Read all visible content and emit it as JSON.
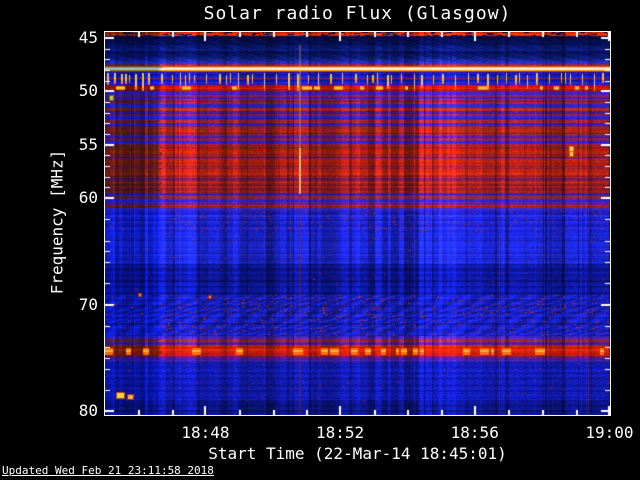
{
  "colors": {
    "background": "#000000",
    "frame": "#ffffff",
    "text": "#ffffff"
  },
  "footer": {
    "updated": "Updated Wed Feb 21 23:11:58 2018"
  },
  "chart_data": {
    "type": "heatmap",
    "title": "Solar radio Flux (Glasgow)",
    "xlabel": "Start Time (22-Mar-14 18:45:01)",
    "ylabel": "Frequency [MHz]",
    "colormap": "blue-red radio spectrogram",
    "x_start_time": "18:45:01",
    "x_end_time": "19:00:00",
    "x_span_min": 15,
    "ylim": [
      44.43,
      80.33
    ],
    "y_inverted": true,
    "x_ticks": [
      {
        "t": 2.983,
        "label": "18:48"
      },
      {
        "t": 6.983,
        "label": "18:52"
      },
      {
        "t": 10.983,
        "label": "18:56"
      },
      {
        "t": 14.983,
        "label": "19:00"
      }
    ],
    "x_minor_ticks": [
      0.983,
      1.983,
      3.983,
      4.983,
      5.983,
      7.983,
      8.983,
      9.983,
      11.983,
      12.983,
      13.983
    ],
    "y_ticks": [
      45,
      50,
      55,
      60,
      70,
      80
    ],
    "y_minor_ticks": [
      46,
      47,
      48,
      49,
      51,
      52,
      53,
      54,
      56,
      57,
      58,
      59,
      62,
      64,
      65,
      66,
      68,
      72,
      74,
      75,
      76,
      78
    ],
    "left_muted_until_min": 1.63,
    "bands": [
      {
        "f0": 44.43,
        "f1": 44.81,
        "style": "mottle",
        "rh": 2,
        "rows": [
          "#b82508",
          "#cc2e06",
          "#7a1808"
        ],
        "gap": "#0a1048"
      },
      {
        "f0": 44.81,
        "f1": 45.4,
        "style": "diag",
        "rh": 3,
        "rows": [
          "#030a46",
          "#05104f",
          "#081457"
        ]
      },
      {
        "f0": 45.4,
        "f1": 46.9,
        "style": "diag",
        "rh": 3,
        "rows": [
          "#061058",
          "#0a1668",
          "#0d1a72"
        ]
      },
      {
        "f0": 46.9,
        "f1": 47.25,
        "style": "diag",
        "rh": 2,
        "rows": [
          "#13207f",
          "#1a2796"
        ]
      },
      {
        "f0": 47.25,
        "f1": 47.62,
        "style": "rows",
        "rh": 2,
        "rows": [
          "#2a2cd2",
          "#8a2240",
          "#2f2fd8",
          "#a82818"
        ]
      },
      {
        "f0": 47.62,
        "f1": 48.2,
        "style": "grows",
        "rows": [
          "#d4590f",
          "#ffbb66",
          "#fff6da",
          "#ffeeb4",
          "#ff9420",
          "#cc2e06"
        ]
      },
      {
        "f0": 48.2,
        "f1": 49.42,
        "style": "comb",
        "rh": 2,
        "rows": [
          "#1619c4",
          "#1216a8",
          "#1d22cf"
        ],
        "spike_top": "#ffd24a",
        "spike_bot": "#ff7712",
        "redrow": "#a81a10"
      },
      {
        "f0": 49.42,
        "f1": 49.98,
        "style": "dash",
        "rh": 2,
        "rows": [
          "#c61605",
          "#d41c02",
          "#aa1405"
        ],
        "bright": [
          "#ff8812",
          "#ffcc44"
        ],
        "density": 0.12
      },
      {
        "f0": 49.98,
        "f1": 50.7,
        "style": "rows",
        "rh": 2,
        "rows": [
          "#45189e",
          "#3a20b4",
          "#82204a",
          "#3a20b4"
        ]
      },
      {
        "f0": 50.7,
        "f1": 55.3,
        "style": "rows",
        "rh": 3,
        "cj": 1,
        "rows": [
          "#3a1cae",
          "#951e28",
          "#2e24c4",
          "#b02212",
          "#51189a",
          "#8a2040",
          "#2a20c8",
          "#a02018"
        ]
      },
      {
        "f0": 55.3,
        "f1": 59.55,
        "style": "rows",
        "rh": 3,
        "cj": 1,
        "rows": [
          "#a01c10",
          "#b82410",
          "#8a1a22",
          "#6a1a56",
          "#b02010",
          "#9a1c14",
          "#7c1a38"
        ]
      },
      {
        "f0": 59.55,
        "f1": 61.2,
        "style": "rows",
        "rh": 3,
        "rows": [
          "#3c1cb0",
          "#8a2036",
          "#2f24c8",
          "#5a1a88",
          "#a82014",
          "#3326c6"
        ]
      },
      {
        "f0": 61.2,
        "f1": 63.2,
        "style": "bars",
        "rh": 2,
        "rows": [
          "#1a20c8",
          "#161ab8",
          "#202ad4"
        ],
        "speck": "#c62a0c",
        "sd": 0.035
      },
      {
        "f0": 63.2,
        "f1": 66.2,
        "style": "bars",
        "rh": 2,
        "rows": [
          "#1a24cc",
          "#1620bc",
          "#1e28d2"
        ],
        "speck": "#b02a10",
        "sd": 0.006
      },
      {
        "f0": 66.2,
        "f1": 69.1,
        "style": "bars",
        "rh": 2,
        "rows": [
          "#0d1694",
          "#101aa4",
          "#0a1280"
        ],
        "speck": "#a02a20",
        "sd": 0.003
      },
      {
        "f0": 69.1,
        "f1": 72.9,
        "style": "wavy",
        "rh": 2,
        "rows": [
          "#141ec0",
          "#1824c8",
          "#1018a8"
        ],
        "speck": "#c62e0a",
        "sd": 0.05
      },
      {
        "f0": 72.9,
        "f1": 74.0,
        "style": "rows",
        "rh": 3,
        "cj": 1,
        "rows": [
          "#3a20b0",
          "#8a2432",
          "#4a1c92",
          "#a32412"
        ]
      },
      {
        "f0": 74.0,
        "f1": 74.78,
        "style": "dash",
        "rh": 2,
        "rows": [
          "#b81a06",
          "#d42202",
          "#c01c05"
        ],
        "bright": [
          "#ff7712",
          "#ffb833"
        ],
        "density": 0.18
      },
      {
        "f0": 74.78,
        "f1": 75.35,
        "style": "rows",
        "rh": 2,
        "rows": [
          "#6a1a62",
          "#46189a",
          "#38209e"
        ]
      },
      {
        "f0": 75.35,
        "f1": 78.9,
        "style": "diagbars",
        "rh": 2,
        "rows": [
          "#121cb4",
          "#151fbe",
          "#0e16a0"
        ],
        "speck": "#a8260e",
        "sd": 0.004
      },
      {
        "f0": 78.9,
        "f1": 80.33,
        "style": "bars",
        "rh": 2,
        "rows": [
          "#0b1286",
          "#0e168f",
          "#081066"
        ],
        "speck": "#902018",
        "sd": 0.002
      }
    ],
    "streaks": [
      {
        "t": 5.79,
        "w": 2,
        "segs": [
          {
            "f0": 45.6,
            "f1": 48.2,
            "c": "#ffcf60",
            "a": 0.28
          },
          {
            "f0": 48.2,
            "f1": 55.3,
            "c": "#ffd877",
            "a": 0.35
          },
          {
            "f0": 55.3,
            "f1": 59.6,
            "c": "#ffe070",
            "a": 0.8
          },
          {
            "f0": 59.6,
            "f1": 80.3,
            "c": "#ff5522",
            "a": 0.2
          }
        ]
      },
      {
        "t": 11.7,
        "w": 1,
        "segs": [
          {
            "f0": 62.0,
            "f1": 80.3,
            "c": "#ff4422",
            "a": 0.18
          }
        ]
      },
      {
        "t": 14.35,
        "w": 1,
        "segs": [
          {
            "f0": 73.5,
            "f1": 80.3,
            "c": "#ff3311",
            "a": 0.3
          }
        ]
      }
    ],
    "blobs": [
      {
        "t": 0.45,
        "f": 78.45,
        "w": 7,
        "h": 5,
        "core": "#ffd835",
        "ring": "#e05500"
      },
      {
        "t": 0.75,
        "f": 78.6,
        "w": 5,
        "h": 4,
        "core": "#ffb040",
        "ring": "#cc3300"
      },
      {
        "t": 13.84,
        "f": 55.4,
        "w": 3,
        "h": 4,
        "core": "#ffe24a",
        "ring": "#ff8800"
      },
      {
        "t": 13.84,
        "f": 55.9,
        "w": 3,
        "h": 4,
        "core": "#ffd040",
        "ring": "#e06000"
      },
      {
        "t": 0.18,
        "f": 50.6,
        "w": 3,
        "h": 4,
        "core": "#c8d42a",
        "ring": "#6a7a10"
      },
      {
        "t": 1.04,
        "f": 69.1,
        "w": 2,
        "h": 2,
        "core": "#ff9020",
        "ring": "#cc3000"
      },
      {
        "t": 3.12,
        "f": 69.3,
        "w": 2,
        "h": 2,
        "core": "#ff8020",
        "ring": "#c03000"
      }
    ]
  }
}
